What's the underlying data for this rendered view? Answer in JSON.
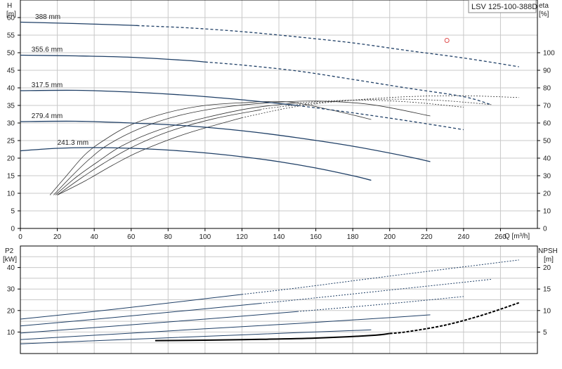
{
  "model_label": "LSV 125-100-388D",
  "colors": {
    "curve": "#1f3f66",
    "grid": "#c8c8c8",
    "axis": "#000000",
    "eta": "#333333",
    "npsh": "#000000",
    "marker": "#e05050"
  },
  "chart_data": [
    {
      "type": "line",
      "id": "head-efficiency",
      "ylabel": "H",
      "yunit": "[m]",
      "ylabel_right": "eta",
      "yunit_right": "[%]",
      "xlabel": "Q [m³/h]",
      "xlim": [
        0,
        280
      ],
      "ylim": [
        0,
        65
      ],
      "ylim_right": [
        0,
        130
      ],
      "grid": true,
      "x_ticks": [
        "0",
        "20",
        "40",
        "60",
        "80",
        "100",
        "120",
        "140",
        "160",
        "180",
        "200",
        "220",
        "240",
        "260"
      ],
      "y_ticks": [
        "0",
        "5",
        "10",
        "15",
        "20",
        "25",
        "30",
        "35",
        "40",
        "45",
        "50",
        "55",
        "60"
      ],
      "y_ticks_right": [
        "0",
        "10",
        "20",
        "30",
        "40",
        "50",
        "60",
        "70",
        "80",
        "90",
        "100"
      ],
      "head_series": [
        {
          "name": "388 mm",
          "x": [
            0,
            30,
            60,
            90,
            120,
            150,
            180,
            210,
            240,
            270
          ],
          "y": [
            58.7,
            58.3,
            57.8,
            57.1,
            56.0,
            54.5,
            52.8,
            50.6,
            48.5,
            46.0
          ],
          "solid_to": 63
        },
        {
          "name": "355.6 mm",
          "x": [
            0,
            30,
            60,
            90,
            120,
            150,
            180,
            210,
            240,
            255
          ],
          "y": [
            49.3,
            49.1,
            48.7,
            47.8,
            46.5,
            44.8,
            42.4,
            39.9,
            37.5,
            35.2
          ],
          "solid_to": 100
        },
        {
          "name": "317.5 mm",
          "x": [
            0,
            30,
            60,
            90,
            120,
            150,
            180,
            210,
            240
          ],
          "y": [
            39.2,
            39.3,
            38.8,
            37.9,
            36.6,
            35.0,
            32.9,
            30.6,
            28.1
          ],
          "solid_to": 150
        },
        {
          "name": "279.4 mm",
          "x": [
            0,
            30,
            60,
            90,
            120,
            150,
            180,
            210,
            222
          ],
          "y": [
            30.4,
            30.5,
            30.0,
            29.2,
            27.8,
            25.8,
            23.4,
            20.4,
            19.0
          ],
          "solid_to": 222
        },
        {
          "name": "241.3 mm",
          "x": [
            0,
            20,
            40,
            60,
            80,
            100,
            120,
            140,
            160,
            180,
            190
          ],
          "y": [
            22.1,
            22.8,
            23.0,
            22.8,
            22.3,
            21.5,
            20.4,
            19.0,
            17.2,
            15.0,
            13.7
          ],
          "solid_to": 190
        }
      ],
      "eta_series": [
        {
          "x": [
            16,
            25,
            35,
            45,
            60,
            80,
            100,
            120,
            145,
            170,
            190
          ],
          "y": [
            19,
            30,
            42,
            50,
            59,
            66,
            70,
            71.5,
            72,
            67,
            62
          ],
          "solid_to": 190
        },
        {
          "x": [
            18,
            28,
            38,
            48,
            65,
            85,
            110,
            135,
            160,
            190,
            222
          ],
          "y": [
            19,
            30,
            40,
            48,
            57,
            64,
            69,
            71.5,
            72.5,
            70.5,
            64
          ],
          "solid_to": 222
        },
        {
          "x": [
            19,
            30,
            42,
            55,
            75,
            100,
            125,
            150,
            180,
            210,
            240
          ],
          "y": [
            19,
            29,
            38,
            47,
            56,
            63,
            68.5,
            71.5,
            73,
            72,
            69
          ],
          "solid_to": 150
        },
        {
          "x": [
            20,
            32,
            45,
            60,
            80,
            105,
            135,
            165,
            195,
            225,
            255
          ],
          "y": [
            19,
            28,
            37,
            46,
            55,
            62.5,
            68.5,
            72,
            73.5,
            73,
            70.5
          ],
          "solid_to": 130
        },
        {
          "x": [
            20,
            35,
            50,
            65,
            90,
            120,
            150,
            180,
            210,
            240,
            270
          ],
          "y": [
            19,
            27,
            36,
            44,
            54,
            63,
            69.5,
            73,
            75,
            75.5,
            74.5
          ],
          "solid_to": 120
        }
      ],
      "marker": {
        "x": 231,
        "y": 53.5
      }
    },
    {
      "type": "line",
      "id": "power-npsh",
      "ylabel": "P2",
      "yunit": "[kW]",
      "ylabel_right": "NPSH",
      "yunit_right": "[m]",
      "xlim": [
        0,
        280
      ],
      "ylim": [
        0,
        50
      ],
      "ylim_right": [
        0,
        25
      ],
      "grid": true,
      "y_ticks": [
        "10",
        "20",
        "30",
        "40"
      ],
      "y_ticks_right": [
        "5",
        "10",
        "15",
        "20"
      ],
      "power_series": [
        {
          "x": [
            0,
            50,
            100,
            150,
            190
          ],
          "y": [
            4.5,
            6.3,
            8.0,
            9.7,
            11.0
          ],
          "solid_to": 190
        },
        {
          "x": [
            0,
            50,
            100,
            150,
            200,
            222
          ],
          "y": [
            6.5,
            9.0,
            11.5,
            14.0,
            16.7,
            18.0
          ],
          "solid_to": 222
        },
        {
          "x": [
            0,
            50,
            100,
            150,
            200,
            240
          ],
          "y": [
            9.5,
            12.7,
            16.0,
            19.5,
            23.2,
            26.5
          ],
          "solid_to": 150
        },
        {
          "x": [
            0,
            50,
            100,
            150,
            200,
            255
          ],
          "y": [
            12.8,
            16.7,
            20.8,
            25.0,
            29.5,
            34.5
          ],
          "solid_to": 130
        },
        {
          "x": [
            0,
            50,
            100,
            150,
            200,
            270
          ],
          "y": [
            16.0,
            20.5,
            25.5,
            30.5,
            36.0,
            43.5
          ],
          "solid_to": 120
        }
      ],
      "npsh_series": {
        "x": [
          73,
          100,
          130,
          160,
          190,
          210,
          230,
          250,
          270
        ],
        "y": [
          3.0,
          3.1,
          3.3,
          3.6,
          4.2,
          5.1,
          6.6,
          8.9,
          11.8
        ],
        "solid_to": 200
      }
    }
  ]
}
